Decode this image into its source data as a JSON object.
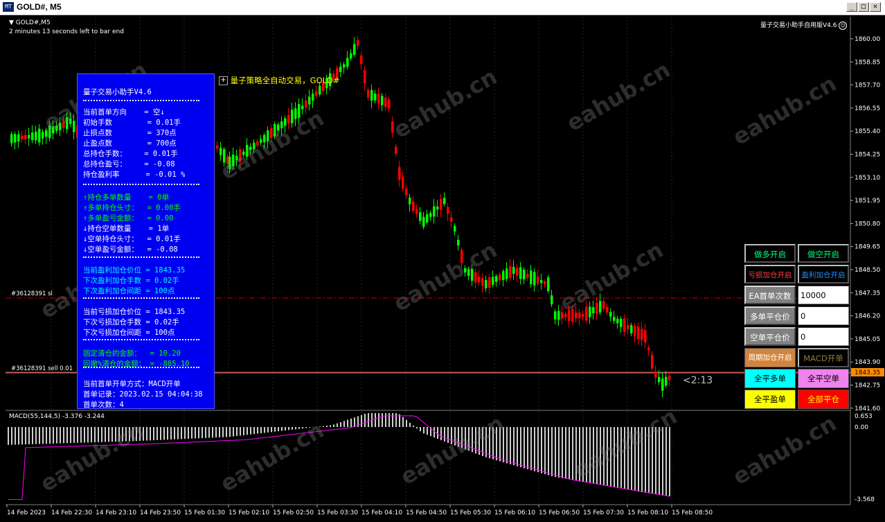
{
  "window": {
    "title": "GOLD#, M5",
    "app_icon_glyph": "MT",
    "minimize": "_",
    "maximize": "□",
    "close": "✕"
  },
  "chart": {
    "symbol": "GOLD#,M5",
    "timer": "2 minutes 13 seconds left to bar end",
    "ea_name": "量子交易小助手自用版V4.6",
    "strategy_label": "量子策略全自动交易，GOLD#",
    "sl_label": "#36128391 sl",
    "sell_label": "#36128391 sell 0.01",
    "current_price": "1843.35",
    "countdown": "<2:13",
    "price_ticks": [
      "1860.00",
      "1858.85",
      "1857.70",
      "1856.55",
      "1855.40",
      "1854.25",
      "1853.10",
      "1851.95",
      "1850.80",
      "1849.65",
      "1848.50",
      "1847.35",
      "1846.20",
      "1845.05",
      "1843.90",
      "1842.75",
      "1841.60"
    ],
    "macd_label": "MACD(55,144,5) -3.376 -3.244",
    "macd_ticks": [
      "0.653",
      "0.00",
      "-3.568"
    ],
    "time_ticks": [
      "14 Feb 2023",
      "14 Feb 22:30",
      "14 Feb 23:10",
      "14 Feb 23:50",
      "15 Feb 01:30",
      "15 Feb 02:10",
      "15 Feb 02:50",
      "15 Feb 03:30",
      "15 Feb 04:10",
      "15 Feb 04:50",
      "15 Feb 05:30",
      "15 Feb 06:10",
      "15 Feb 06:50",
      "15 Feb 07:30",
      "15 Feb 08:10",
      "15 Feb 08:50"
    ],
    "watermark": "eahub.cn",
    "colors": {
      "bull": "#00ff00",
      "bear": "#ff0000",
      "macd": "#ff00ff",
      "grid": "#ffffff"
    }
  },
  "panel": {
    "title": "量子交易小助手V4.6",
    "lines": [
      {
        "text": "当前首单方向    = 空",
        "color": "#ffffff",
        "arrow": "down"
      },
      {
        "text": "初始手数        = 0.01手",
        "color": "#ffffff"
      },
      {
        "text": "止损点数        = 370点",
        "color": "#ffffff"
      },
      {
        "text": "止盈点数        = 700点",
        "color": "#ffffff"
      },
      {
        "text": "总持仓手数：    = 0.01手",
        "color": "#ffffff"
      },
      {
        "text": "总持仓盈亏：    = -0.08",
        "color": "#ffffff"
      },
      {
        "text": "持仓盈利率      = -0.01 %",
        "color": "#ffffff"
      },
      {
        "text": "↑持仓多单数量    = 0单",
        "color": "#00ff00"
      },
      {
        "text": "↑多单持仓头寸：  = 0.00手",
        "color": "#00ff00"
      },
      {
        "text": "↑多单盈亏金额：  = 0.00",
        "color": "#00ff00"
      },
      {
        "text": "↓持仓空单数量    = 1单",
        "color": "#ffffff"
      },
      {
        "text": "↓空单持仓头寸：  = 0.01手",
        "color": "#ffffff"
      },
      {
        "text": "↓空单盈亏金额：  = -0.08",
        "color": "#ffffff"
      },
      {
        "text": "当前盈利加仓价位 = 1843.35",
        "color": "#00ffff"
      },
      {
        "text": "下次盈利加仓手数 = 0.02手",
        "color": "#00ffff"
      },
      {
        "text": "下次盈利加仓间距 = 100点",
        "color": "#00ffff"
      },
      {
        "text": "当前亏损加仓价位 = 1843.35",
        "color": "#ffffff"
      },
      {
        "text": "下次亏损加仓手数 = 0.02手",
        "color": "#ffffff"
      },
      {
        "text": "下次亏损加仓间距 = 100点",
        "color": "#ffffff"
      },
      {
        "text": "固定清仓的金额：  = 10.20",
        "color": "#00ff00"
      },
      {
        "text": "回撤%清仓的金额： = -885.10",
        "color": "#00ff00"
      },
      {
        "text": "当前首单开单方式：MACD开单",
        "color": "#ffffff"
      },
      {
        "text": "首单记录：2023.02.15 04:04:38",
        "color": "#ffffff"
      },
      {
        "text": "首单次数：4",
        "color": "#ffffff"
      }
    ]
  },
  "controls": {
    "open_long": "做多开启",
    "open_short": "做空开启",
    "loss_add": "亏损加仓开启",
    "profit_add": "盈利加仓开启",
    "ea_count_label": "EA首单次数",
    "ea_count_value": "10000",
    "long_close_label": "多单平仓价",
    "long_close_value": "0",
    "short_close_label": "空单平仓价",
    "short_close_value": "0",
    "period_add": "周期加仓开启",
    "macd_open": "MACD开单",
    "close_all_long": "全平多单",
    "close_all_short": "全平空单",
    "close_profit": "全平盈单",
    "close_all": "全部平仓"
  }
}
